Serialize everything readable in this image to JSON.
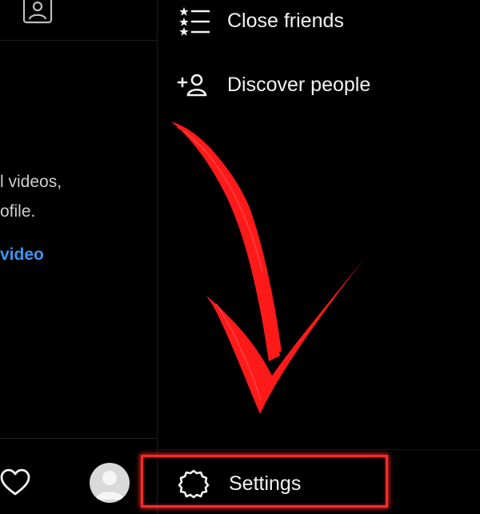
{
  "left_panel": {
    "text_line_1": "l videos,",
    "text_line_2": "ofile.",
    "link": "video"
  },
  "menu": {
    "items": [
      {
        "label": "Close friends",
        "icon": "close-friends-list-icon"
      },
      {
        "label": "Discover people",
        "icon": "add-person-icon"
      }
    ],
    "settings": {
      "label": "Settings",
      "icon": "gear-icon"
    }
  },
  "annotation": {
    "arrow_color": "#ff1a1a",
    "highlight_color": "#ff2a2a"
  },
  "colors": {
    "background": "#000000",
    "text": "#f2f2f2",
    "link": "#3c95ef"
  }
}
